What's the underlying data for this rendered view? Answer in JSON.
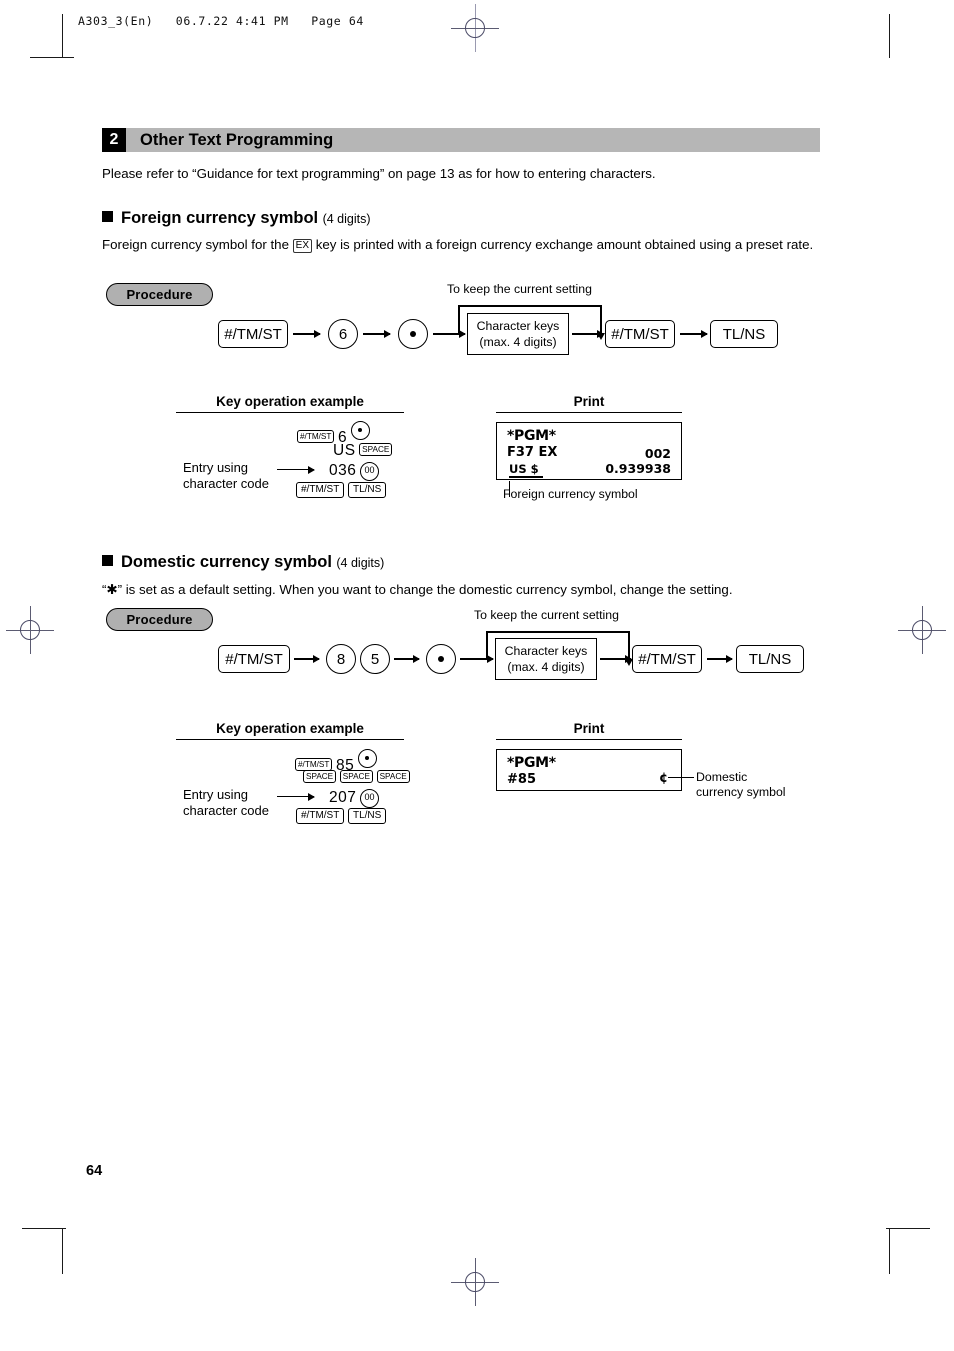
{
  "page_header": "A303_3(En)   06.7.22 4:41 PM   Page 64",
  "page_number": "64",
  "section": {
    "number": "2",
    "title": "Other Text Programming",
    "intro": "Please refer to “Guidance for text programming” on page 13 as for how to entering characters."
  },
  "foreign": {
    "heading": "Foreign currency symbol",
    "digits": "(4 digits)",
    "body_pre": "Foreign currency symbol for the",
    "body_key": "EX",
    "body_post": "key is printed with a foreign currency exchange amount obtained using a",
    "body_line2": "preset rate.",
    "procedure_label": "Procedure",
    "keep_label": "To keep the current setting",
    "flow": {
      "key1": "#/TM/ST",
      "num1": "6",
      "dot": "•",
      "charbox_line1": "Character keys",
      "charbox_line2": "(max. 4 digits)",
      "key2": "#/TM/ST",
      "key3": "TL/NS"
    },
    "example": {
      "title": "Key operation example",
      "row1_key": "#/TM/ST",
      "row1_num": "6",
      "row2_text": "US",
      "row2_key": "SPACE",
      "row3_num": "036",
      "row3_key": "00",
      "row4_key1": "#/TM/ST",
      "row4_key2": "TL/NS",
      "entry_label_line1": "Entry using",
      "entry_label_line2": "character code"
    },
    "print": {
      "title": "Print",
      "line1": "*PGM*",
      "line2_left": "F37 EX",
      "line2_right": "002",
      "line3_left": "US $",
      "line3_right": "0.939938",
      "caption": "Foreign currency symbol"
    }
  },
  "domestic": {
    "heading": "Domestic currency symbol",
    "digits": "(4 digits)",
    "body": "“✱” is set as a default setting.  When you want to change the domestic currency symbol, change the setting.",
    "procedure_label": "Procedure",
    "keep_label": "To keep the current setting",
    "flow": {
      "key1": "#/TM/ST",
      "num1": "8",
      "num2": "5",
      "dot": "•",
      "charbox_line1": "Character keys",
      "charbox_line2": "(max. 4 digits)",
      "key2": "#/TM/ST",
      "key3": "TL/NS"
    },
    "example": {
      "title": "Key operation example",
      "row1_key": "#/TM/ST",
      "row1_num": "85",
      "row2_key1": "SPACE",
      "row2_key2": "SPACE",
      "row2_key3": "SPACE",
      "row3_num": "207",
      "row3_key": "00",
      "row4_key1": "#/TM/ST",
      "row4_key2": "TL/NS",
      "entry_label_line1": "Entry using",
      "entry_label_line2": "character code"
    },
    "print": {
      "title": "Print",
      "line1": "*PGM*",
      "line2_left": "#85",
      "line2_right": "¢",
      "caption_line1": "Domestic",
      "caption_line2": "currency symbol"
    }
  }
}
